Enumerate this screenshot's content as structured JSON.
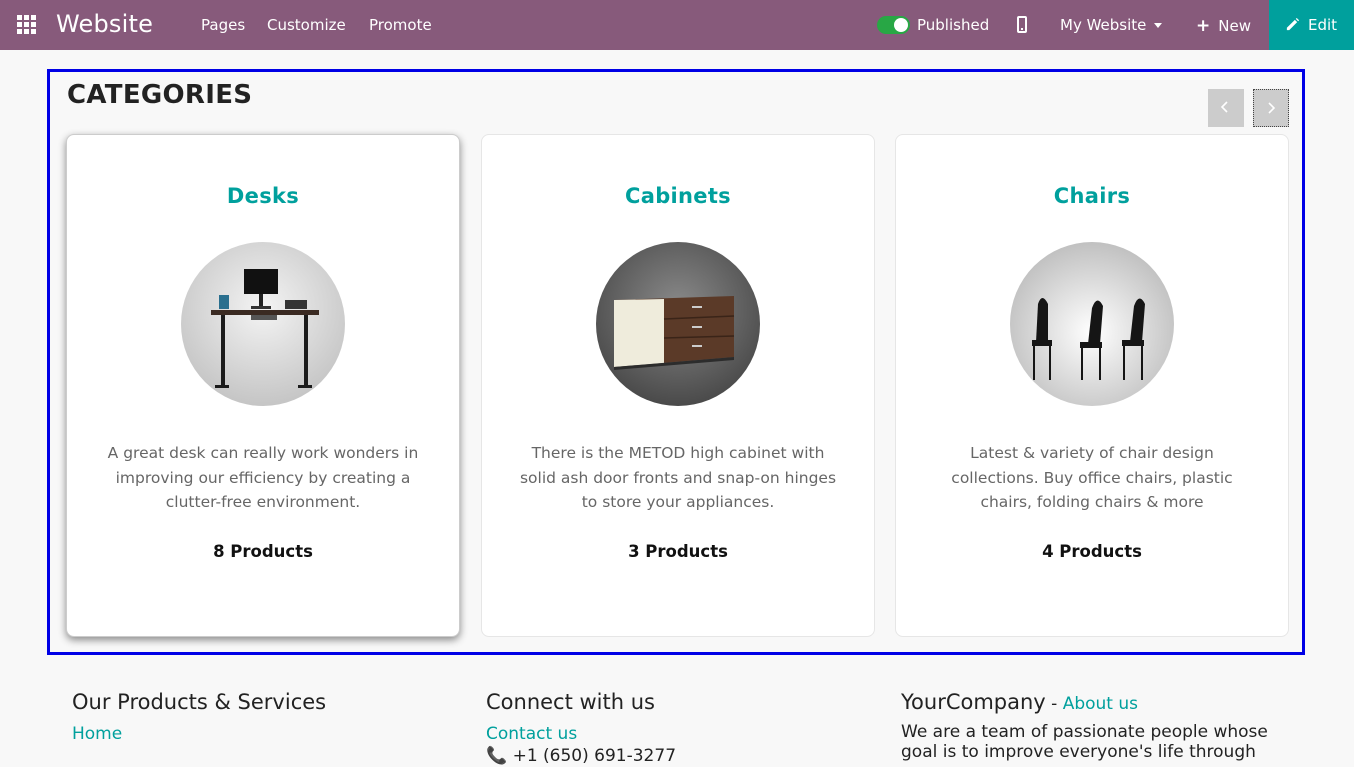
{
  "navbar": {
    "brand": "Website",
    "menu": [
      "Pages",
      "Customize",
      "Promote"
    ],
    "published_label": "Published",
    "site_selector": "My Website",
    "new_label": "New",
    "edit_label": "Edit",
    "bg_color": "#875a7b",
    "edit_color": "#00a09d"
  },
  "categories": {
    "title": "CATEGORIES",
    "cards": [
      {
        "name": "Desks",
        "description": "A great desk can really work wonders in improving our efficiency by creating a clutter-free environment.",
        "count": "8 Products"
      },
      {
        "name": "Cabinets",
        "description": "There is the METOD high cabinet with solid ash door fronts and snap-on hinges to store your appliances.",
        "count": "3 Products"
      },
      {
        "name": "Chairs",
        "description": "Latest & variety of chair design collections. Buy office chairs, plastic chairs, folding chairs & more",
        "count": "4 Products"
      }
    ]
  },
  "footer": {
    "col1": {
      "heading": "Our Products & Services",
      "link": "Home"
    },
    "col2": {
      "heading": "Connect with us",
      "link": "Contact us",
      "phone": "+1 (650) 691-3277"
    },
    "col3": {
      "heading": "YourCompany",
      "separator": " - ",
      "link": "About us",
      "text_line1": "We are a team of passionate people whose",
      "text_line2": "goal is to improve everyone's life through"
    }
  }
}
